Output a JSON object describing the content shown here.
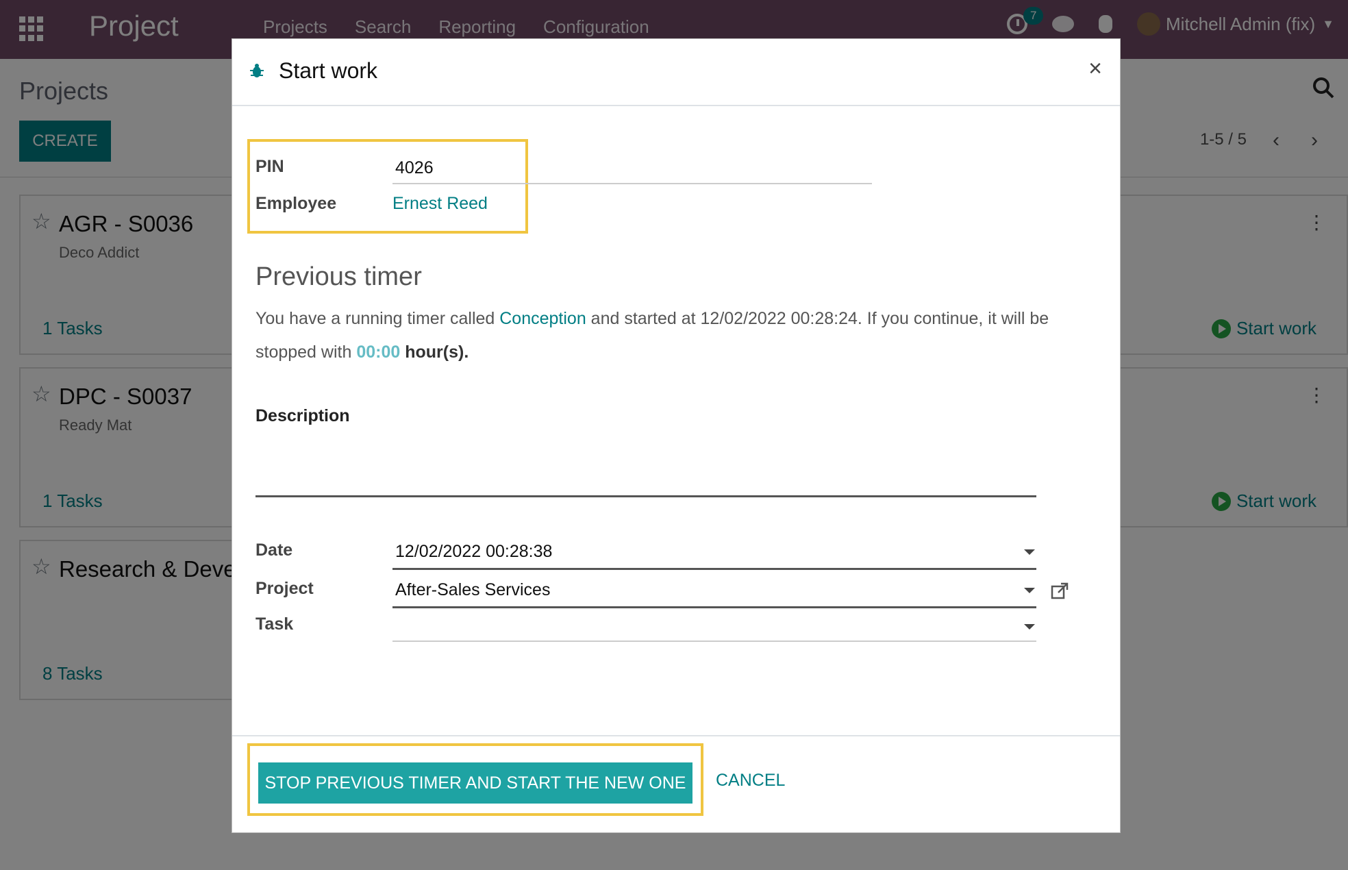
{
  "navbar": {
    "brand": "Project",
    "menu": [
      "Projects",
      "Search",
      "Reporting",
      "Configuration"
    ],
    "activity_count": "7",
    "user": "Mitchell Admin (fix)"
  },
  "control_panel": {
    "breadcrumb": "Projects",
    "create_label": "CREATE",
    "pager": "1-5 / 5"
  },
  "kanban": {
    "cards": [
      {
        "title": "AGR - S0036",
        "subtitle": "Deco Addict",
        "tasks": "1 Tasks",
        "action": "Start work"
      },
      {
        "title": "DPC - S0037",
        "subtitle": "Ready Mat",
        "tasks": "1 Tasks",
        "action": "Start work"
      },
      {
        "title": "Research & Devel",
        "subtitle": "",
        "tasks": "8 Tasks",
        "action": ""
      }
    ]
  },
  "modal": {
    "title": "Start work",
    "pin_label": "PIN",
    "pin_value": "4026",
    "employee_label": "Employee",
    "employee_value": "Ernest Reed",
    "previous_timer_title": "Previous timer",
    "timer_text_1": "You have a running timer called ",
    "timer_task": "Conception",
    "timer_text_2": " and started at 12/02/2022 00:28:24. If you continue, it will be stopped with ",
    "timer_hours": "00:00",
    "timer_text_3": " hour(s).",
    "description_label": "Description",
    "date_label": "Date",
    "date_value": "12/02/2022 00:28:38",
    "project_label": "Project",
    "project_value": "After-Sales Services",
    "task_label": "Task",
    "task_value": "",
    "primary_button": "STOP PREVIOUS TIMER AND START THE NEW ONE",
    "cancel_button": "CANCEL"
  },
  "colors": {
    "navbar": "#714b67",
    "accent": "#017e84",
    "primary_button": "#1ea3a3",
    "highlight": "#f0c541"
  }
}
